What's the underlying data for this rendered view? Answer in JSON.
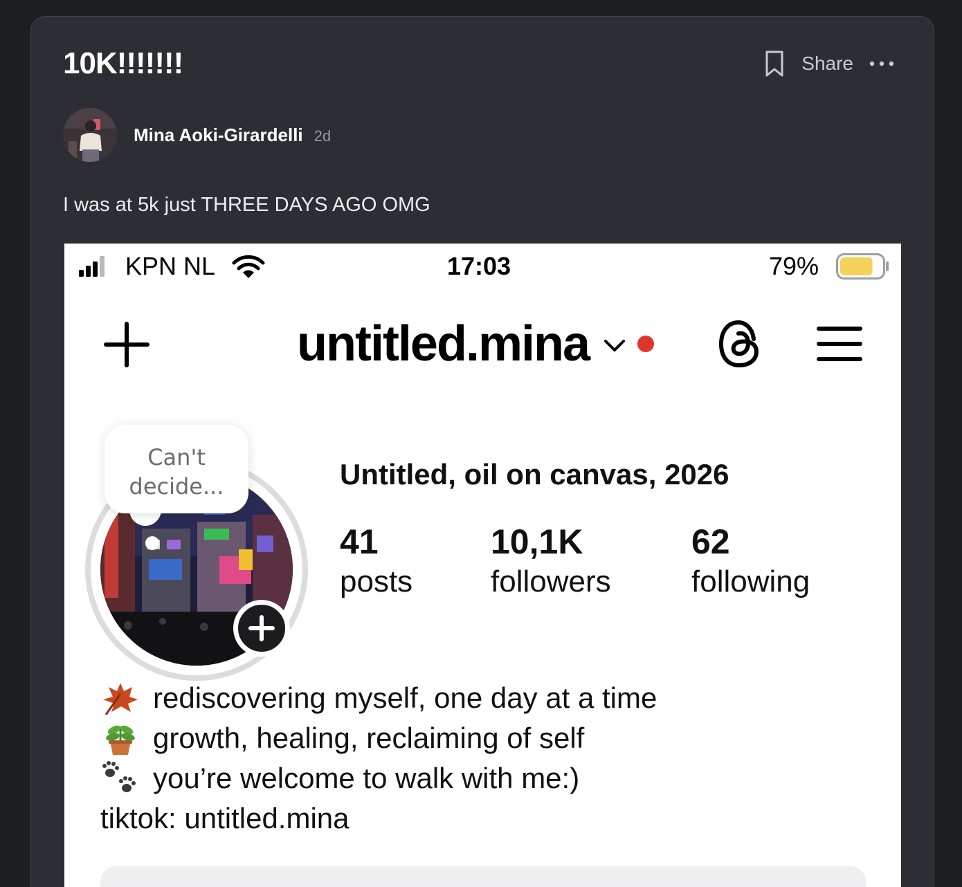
{
  "post": {
    "title": "10K!!!!!!!",
    "share_label": "Share",
    "author": "Mina Aoki-Girardelli",
    "time": "2d",
    "body": "I was at 5k just THREE DAYS AGO OMG"
  },
  "screenshot": {
    "status_bar": {
      "carrier": "KPN NL",
      "time": "17:03",
      "battery": "79%",
      "battery_level": 0.79,
      "battery_color": "#f5d25c"
    },
    "nav": {
      "username": "untitled.mina",
      "notification_color": "#e0352b"
    },
    "note_bubble": {
      "line1": "Can't",
      "line2": "decide..."
    },
    "profile": {
      "name": "Untitled, oil on canvas, 2026",
      "stats": [
        {
          "value": "41",
          "label": "posts"
        },
        {
          "value": "10,1K",
          "label": "followers"
        },
        {
          "value": "62",
          "label": "following"
        }
      ],
      "bio": [
        {
          "emoji": "maple-leaf-icon",
          "text": "rediscovering myself, one day at a time"
        },
        {
          "emoji": "potted-plant-icon",
          "text": "growth, healing, reclaiming of self"
        },
        {
          "emoji": "paw-prints-icon",
          "text": "you’re welcome to walk with me:)"
        }
      ],
      "link": "tiktok: untitled.mina"
    }
  }
}
